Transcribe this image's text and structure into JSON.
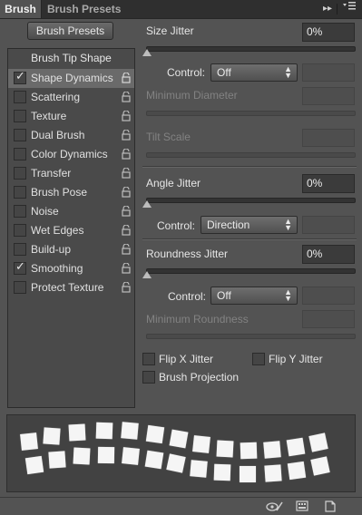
{
  "tabs": {
    "active": "Brush",
    "inactive": "Brush Presets",
    "expand": "▸▸"
  },
  "presets_button": "Brush Presets",
  "left": {
    "title": "Brush Tip Shape",
    "items": [
      {
        "label": "Shape Dynamics",
        "checked": true
      },
      {
        "label": "Scattering",
        "checked": false
      },
      {
        "label": "Texture",
        "checked": false
      },
      {
        "label": "Dual Brush",
        "checked": false
      },
      {
        "label": "Color Dynamics",
        "checked": false
      },
      {
        "label": "Transfer",
        "checked": false
      },
      {
        "label": "Brush Pose",
        "checked": false
      },
      {
        "label": "Noise",
        "checked": false
      },
      {
        "label": "Wet Edges",
        "checked": false
      },
      {
        "label": "Build-up",
        "checked": false
      },
      {
        "label": "Smoothing",
        "checked": true
      },
      {
        "label": "Protect Texture",
        "checked": false
      }
    ]
  },
  "right": {
    "size_jitter": {
      "label": "Size Jitter",
      "value": "0%"
    },
    "control1": {
      "label": "Control:",
      "value": "Off"
    },
    "min_diameter": "Minimum Diameter",
    "tilt_scale": "Tilt Scale",
    "angle_jitter": {
      "label": "Angle Jitter",
      "value": "0%"
    },
    "control2": {
      "label": "Control:",
      "value": "Direction"
    },
    "roundness_jitter": {
      "label": "Roundness Jitter",
      "value": "0%"
    },
    "control3": {
      "label": "Control:",
      "value": "Off"
    },
    "min_roundness": "Minimum Roundness",
    "flip_x": "Flip X Jitter",
    "flip_y": "Flip Y Jitter",
    "brush_projection": "Brush Projection"
  },
  "check_glyph": "✓"
}
